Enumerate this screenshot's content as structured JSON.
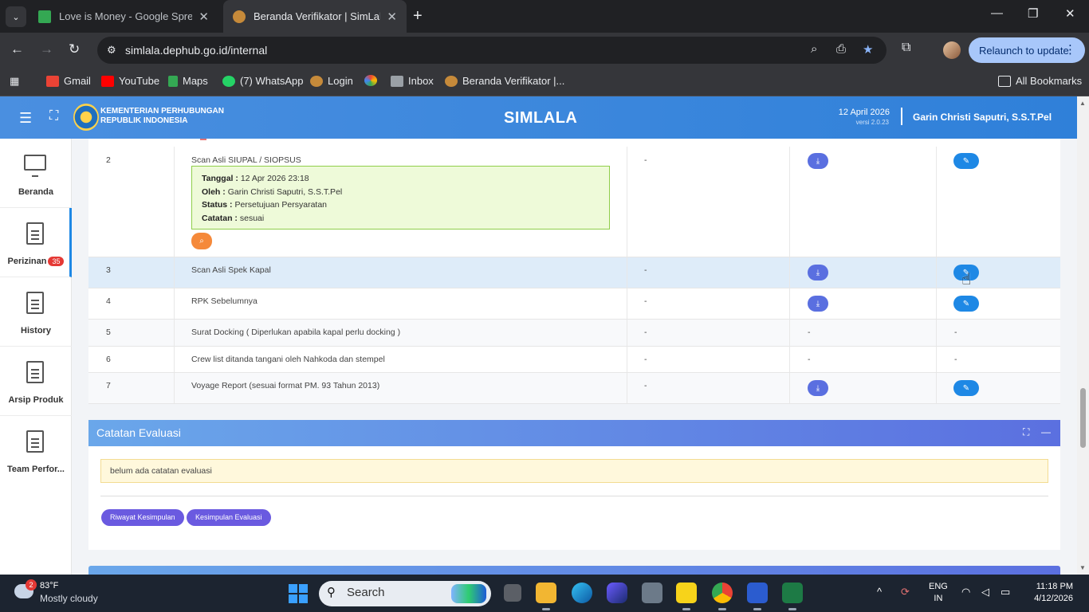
{
  "browser": {
    "tabs": [
      {
        "title": "Love is Money - Google Spread",
        "favicon_color": "#34a853"
      },
      {
        "title": "Beranda Verifikator | SimLala",
        "favicon_color": "#c68a3a"
      }
    ],
    "url": "simlala.dephub.go.id/internal",
    "relaunch_label": "Relaunch to update",
    "bookmarks": [
      {
        "label": "Gmail",
        "color": "#ea4335"
      },
      {
        "label": "YouTube",
        "color": "#ff0000"
      },
      {
        "label": "Maps",
        "color": "#34a853"
      },
      {
        "label": "(7) WhatsApp",
        "color": "#25d366"
      },
      {
        "label": "Login",
        "color": "#c68a3a"
      },
      {
        "label": "",
        "color": "#fbbc04"
      },
      {
        "label": "Inbox",
        "color": "#9aa0a6"
      },
      {
        "label": "Beranda Verifikator |...",
        "color": "#c68a3a"
      }
    ],
    "all_bookmarks_label": "All Bookmarks"
  },
  "app": {
    "ministry_line1": "KEMENTERIAN PERHUBUNGAN",
    "ministry_line2": "REPUBLIK INDONESIA",
    "name": "SIMLALA",
    "date": "12 April 2026",
    "version": "versi 2.0.23",
    "user": "Garin Christi Saputri, S.S.T.Pel"
  },
  "sidebar": {
    "items": [
      {
        "label": "Beranda"
      },
      {
        "label": "Perizinan",
        "badge": "35"
      },
      {
        "label": "History"
      },
      {
        "label": "Arsip Produk"
      },
      {
        "label": "Team Perfor..."
      }
    ]
  },
  "documents": {
    "rows": [
      {
        "no": "2",
        "name": "Scan Asli SIUPAL / SIOPSUS",
        "col3": "-",
        "info": {
          "tanggal_label": "Tanggal :",
          "tanggal": "12 Apr 2026 23:18",
          "oleh_label": "Oleh :",
          "oleh": "Garin Christi Saputri, S.S.T.Pel",
          "status_label": "Status :",
          "status": "Persetujuan Persyaratan",
          "catatan_label": "Catatan :",
          "catatan": "sesuai"
        }
      },
      {
        "no": "3",
        "name": "Scan Asli Spek Kapal",
        "col3": "-"
      },
      {
        "no": "4",
        "name": "RPK Sebelumnya",
        "col3": "-"
      },
      {
        "no": "5",
        "name": "Surat Docking ( Diperlukan apabila kapal perlu docking )",
        "col3": "-",
        "col4": "-",
        "col5": "-"
      },
      {
        "no": "6",
        "name": "Crew list ditanda tangani oleh Nahkoda dan stempel",
        "col3": "-",
        "col4": "-",
        "col5": "-"
      },
      {
        "no": "7",
        "name": "Voyage Report (sesuai format PM. 93 Tahun 2013)",
        "col3": "-"
      }
    ]
  },
  "evaluation": {
    "title": "Catatan Evaluasi",
    "empty_message": "belum ada catatan evaluasi",
    "riwayat_button": "Riwayat Kesimpulan",
    "kesimpulan_button": "Kesimpulan Evaluasi"
  },
  "taskbar": {
    "weather_badge": "2",
    "temperature": "83°F",
    "weather": "Mostly cloudy",
    "search_label": "Search",
    "lang_line1": "ENG",
    "lang_line2": "IN",
    "time": "11:18 PM",
    "date": "4/12/2026"
  }
}
